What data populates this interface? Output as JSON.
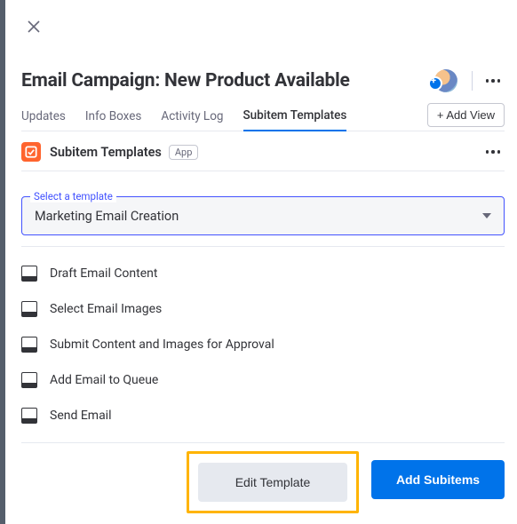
{
  "header": {
    "title": "Email Campaign: New Product Available"
  },
  "tabs": [
    {
      "label": "Updates",
      "active": false
    },
    {
      "label": "Info Boxes",
      "active": false
    },
    {
      "label": "Activity Log",
      "active": false
    },
    {
      "label": "Subitem Templates",
      "active": true
    }
  ],
  "add_view_label": "+ Add View",
  "section": {
    "title": "Subitem Templates",
    "badge": "App"
  },
  "template_select": {
    "label": "Select a template",
    "value": "Marketing Email Creation"
  },
  "subitems": [
    "Draft Email Content",
    "Select Email Images",
    "Submit Content and Images for Approval",
    "Add Email to Queue",
    "Send Email"
  ],
  "actions": {
    "edit_template": "Edit Template",
    "add_subitems": "Add Subitems"
  }
}
